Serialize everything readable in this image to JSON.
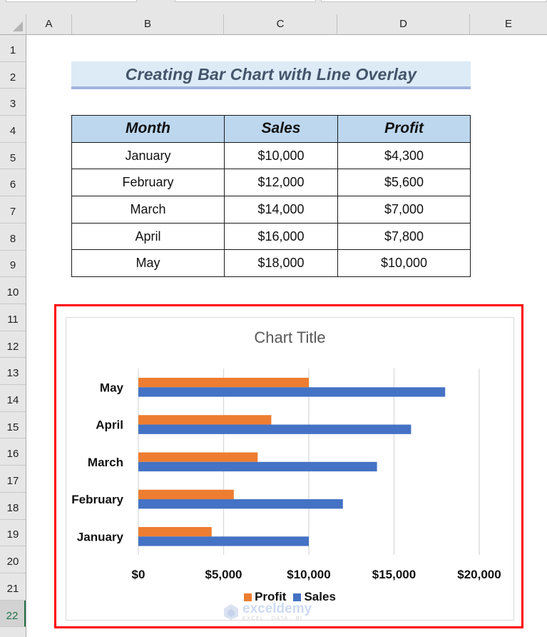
{
  "spreadsheet": {
    "columns": [
      "A",
      "B",
      "C",
      "D",
      "E"
    ],
    "rows": [
      "1",
      "2",
      "3",
      "4",
      "5",
      "6",
      "7",
      "8",
      "9",
      "10",
      "11",
      "12",
      "13",
      "14",
      "15",
      "16",
      "17",
      "18",
      "19",
      "20",
      "21",
      "22"
    ],
    "selected_row": "22"
  },
  "banner": {
    "title": "Creating Bar Chart with Line Overlay"
  },
  "table": {
    "headers": {
      "month": "Month",
      "sales": "Sales",
      "profit": "Profit"
    },
    "rows": [
      {
        "month": "January",
        "sales": "$10,000",
        "profit": "$4,300"
      },
      {
        "month": "February",
        "sales": "$12,000",
        "profit": "$5,600"
      },
      {
        "month": "March",
        "sales": "$14,000",
        "profit": "$7,000"
      },
      {
        "month": "April",
        "sales": "$16,000",
        "profit": "$7,800"
      },
      {
        "month": "May",
        "sales": "$18,000",
        "profit": "$10,000"
      }
    ]
  },
  "colors": {
    "profit": "#ed7d31",
    "sales": "#4472c4",
    "highlight_frame": "#ff0000",
    "header_fill": "#bdd7ee",
    "banner_fill": "#ddebf7"
  },
  "watermark": {
    "brand": "exceldemy",
    "tagline": "EXCEL · DATA · BI"
  },
  "chart_data": {
    "type": "bar",
    "orientation": "horizontal",
    "title": "Chart Title",
    "categories": [
      "January",
      "February",
      "March",
      "April",
      "May"
    ],
    "series": [
      {
        "name": "Profit",
        "color": "#ed7d31",
        "values": [
          4300,
          5600,
          7000,
          7800,
          10000
        ]
      },
      {
        "name": "Sales",
        "color": "#4472c4",
        "values": [
          10000,
          12000,
          14000,
          16000,
          18000
        ]
      }
    ],
    "xlim": [
      0,
      20000
    ],
    "xticks": [
      0,
      5000,
      10000,
      15000,
      20000
    ],
    "xtick_labels": [
      "$0",
      "$5,000",
      "$10,000",
      "$15,000",
      "$20,000"
    ],
    "xlabel": "",
    "ylabel": "",
    "grid": true,
    "legend": [
      "Profit",
      "Sales"
    ],
    "legend_position": "bottom"
  }
}
